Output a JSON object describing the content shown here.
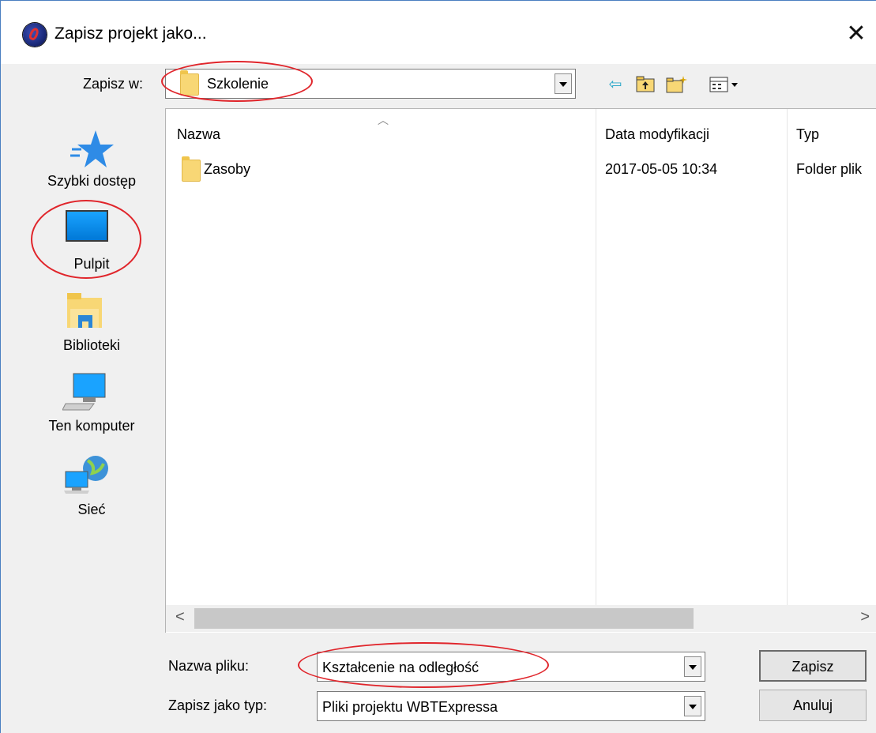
{
  "dialog": {
    "title": "Zapisz projekt jako...",
    "close_glyph": "✕"
  },
  "save_in": {
    "label": "Zapisz w:",
    "value": "Szkolenie"
  },
  "toolbar": {
    "icons": [
      "back-icon",
      "up-folder-icon",
      "new-folder-icon",
      "view-menu-icon"
    ],
    "glyphs": {
      "back": "⇦",
      "up": "⇧",
      "new": "✱",
      "view": "▦▾"
    }
  },
  "places": [
    {
      "label": "Szybki dostęp",
      "icon": "quick-access-star-icon"
    },
    {
      "label": "Pulpit",
      "icon": "desktop-icon"
    },
    {
      "label": "Biblioteki",
      "icon": "libraries-icon"
    },
    {
      "label": "Ten komputer",
      "icon": "computer-icon"
    },
    {
      "label": "Sieć",
      "icon": "network-icon"
    }
  ],
  "file_list": {
    "columns": [
      "Nazwa",
      "Data modyfikacji",
      "Typ"
    ],
    "rows": [
      {
        "name": "Zasoby",
        "modified": "2017-05-05 10:34",
        "type": "Folder plik"
      }
    ],
    "scroll_left": "<",
    "scroll_right": ">"
  },
  "filename": {
    "label": "Nazwa pliku:",
    "value": "Kształcenie na odległość"
  },
  "filetype": {
    "label": "Zapisz jako typ:",
    "value": "Pliki projektu WBTExpressa"
  },
  "buttons": {
    "save": "Zapisz",
    "cancel": "Anuluj"
  },
  "colors": {
    "annotation": "#e0252b",
    "folder": "#f8d775",
    "accent": "#1e90ff"
  }
}
